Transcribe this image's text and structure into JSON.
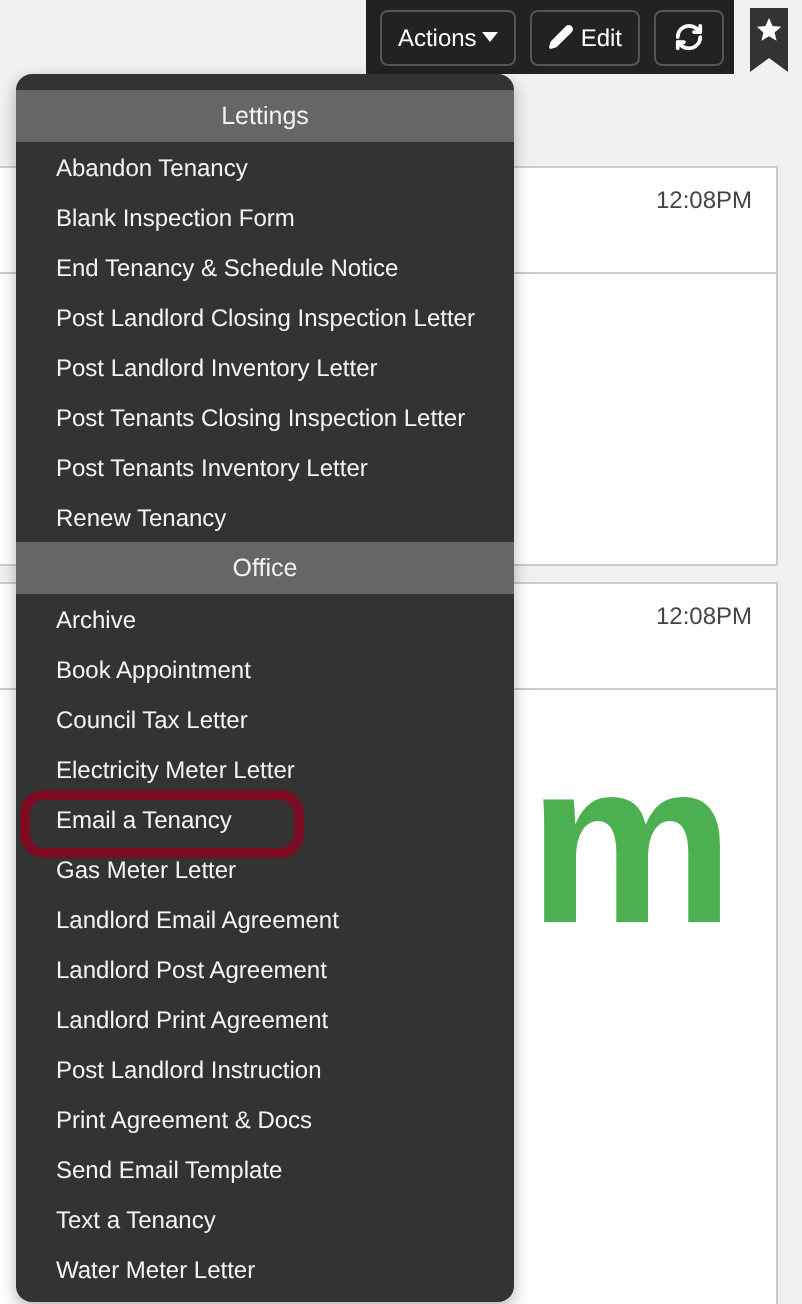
{
  "toolbar": {
    "buttons": [
      {
        "kind": "dropdown",
        "label": "Actions"
      },
      {
        "kind": "edit",
        "label": "Edit"
      },
      {
        "kind": "refresh"
      }
    ]
  },
  "menu": {
    "sections": [
      {
        "title": "Lettings",
        "items": [
          {
            "label": "Abandon Tenancy",
            "circled": false
          },
          {
            "label": "Blank Inspection Form",
            "circled": false
          },
          {
            "label": "End Tenancy & Schedule Notice",
            "circled": false
          },
          {
            "label": "Post Landlord Closing Inspection Letter",
            "circled": false
          },
          {
            "label": "Post Landlord Inventory Letter",
            "circled": false
          },
          {
            "label": "Post Tenants Closing Inspection Letter",
            "circled": false
          },
          {
            "label": "Post Tenants Inventory Letter",
            "circled": false
          },
          {
            "label": "Renew Tenancy",
            "circled": false
          }
        ]
      },
      {
        "title": "Office",
        "items": [
          {
            "label": "Archive",
            "circled": false
          },
          {
            "label": "Book Appointment",
            "circled": false
          },
          {
            "label": "Council Tax Letter",
            "circled": false
          },
          {
            "label": "Electricity Meter Letter",
            "circled": false
          },
          {
            "label": "Email a Tenancy",
            "circled": true
          },
          {
            "label": "Gas Meter Letter",
            "circled": false
          },
          {
            "label": "Landlord Email Agreement",
            "circled": false
          },
          {
            "label": "Landlord Post Agreement",
            "circled": false
          },
          {
            "label": "Landlord Print Agreement",
            "circled": false
          },
          {
            "label": "Post Landlord Instruction",
            "circled": false
          },
          {
            "label": "Print Agreement & Docs",
            "circled": false
          },
          {
            "label": "Send Email Template",
            "circled": false
          },
          {
            "label": "Text a Tenancy",
            "circled": false
          },
          {
            "label": "Water Meter Letter",
            "circled": false
          }
        ]
      }
    ]
  },
  "cards": [
    {
      "time": "12:08PM"
    },
    {
      "time": "12:08PM",
      "price_fragment": "m"
    }
  ]
}
